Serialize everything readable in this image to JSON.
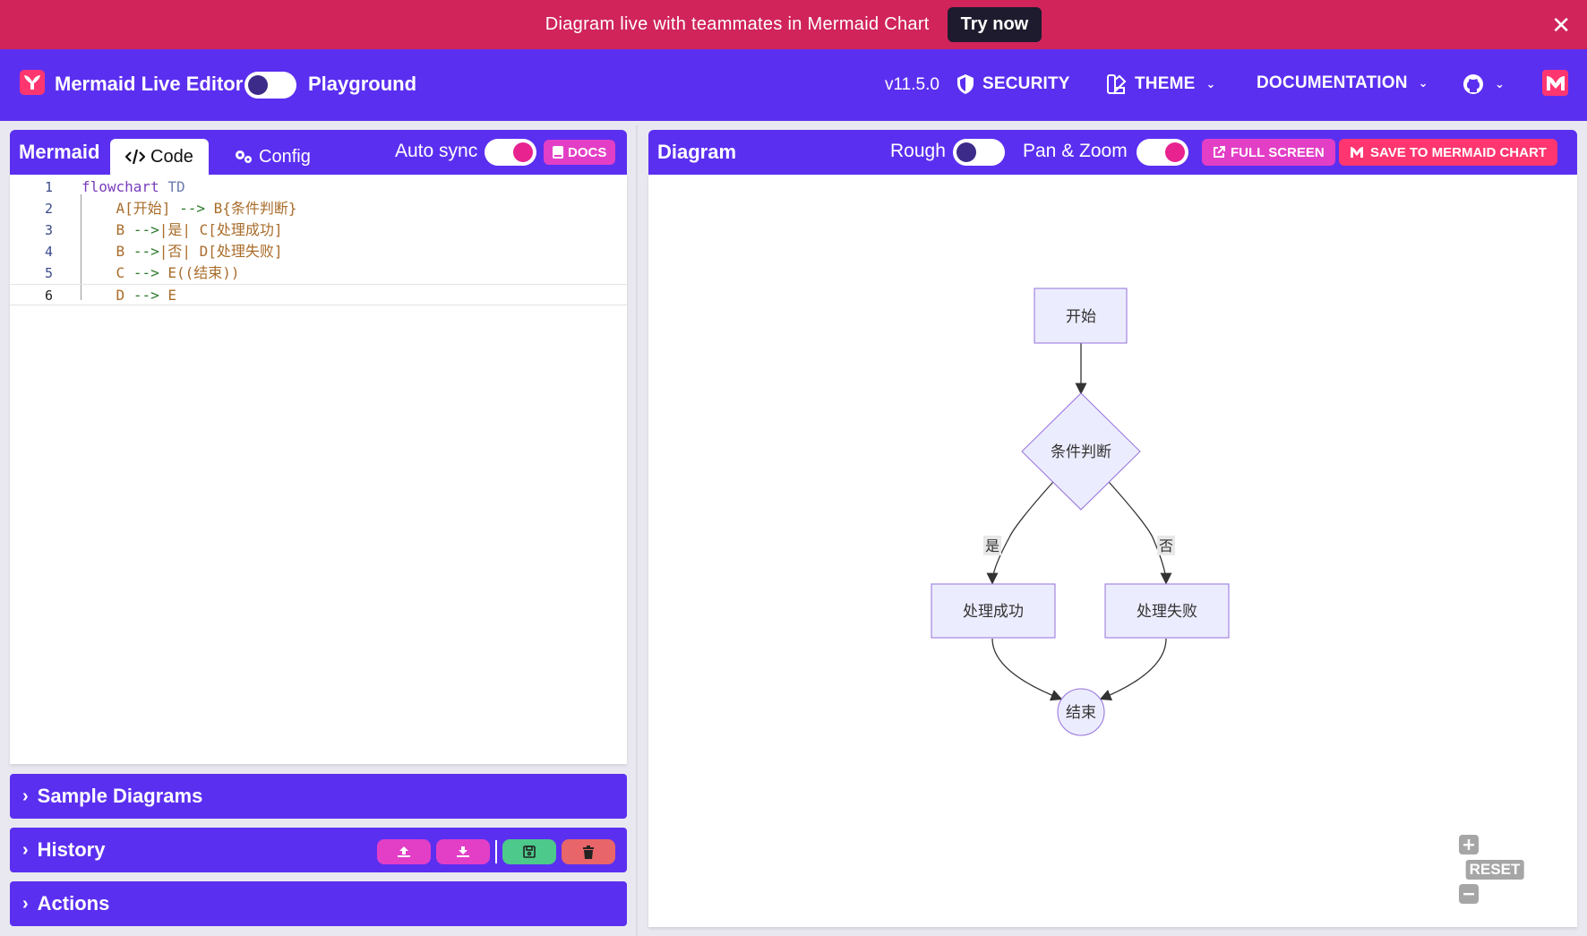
{
  "banner": {
    "text": "Diagram live with teammates in Mermaid Chart",
    "button": "Try now",
    "close": "✕"
  },
  "header": {
    "title": "Mermaid Live Editor",
    "playground": "Playground",
    "version": "v11.5.0",
    "nav": {
      "security": "SECURITY",
      "theme": "THEME",
      "documentation": "DOCUMENTATION"
    }
  },
  "editor_panel": {
    "title": "Mermaid",
    "tabs": [
      "Code",
      "Config"
    ],
    "auto_sync": "Auto sync",
    "docs": "DOCS",
    "lines": [
      {
        "n": "1",
        "parts": [
          [
            "kw",
            "flowchart"
          ],
          [
            "sp",
            " "
          ],
          [
            "dir",
            "TD"
          ]
        ]
      },
      {
        "n": "2",
        "parts": [
          [
            "sp",
            "    "
          ],
          [
            "tok",
            "A[开始]"
          ],
          [
            "sp",
            " "
          ],
          [
            "arr",
            "-->"
          ],
          [
            "sp",
            " "
          ],
          [
            "tok",
            "B{条件判断}"
          ]
        ]
      },
      {
        "n": "3",
        "parts": [
          [
            "sp",
            "    "
          ],
          [
            "tok",
            "B"
          ],
          [
            "sp",
            " "
          ],
          [
            "arr",
            "-->"
          ],
          [
            "tok",
            "|是|"
          ],
          [
            "sp",
            " "
          ],
          [
            "tok",
            "C[处理成功]"
          ]
        ]
      },
      {
        "n": "4",
        "parts": [
          [
            "sp",
            "    "
          ],
          [
            "tok",
            "B"
          ],
          [
            "sp",
            " "
          ],
          [
            "arr",
            "-->"
          ],
          [
            "tok",
            "|否|"
          ],
          [
            "sp",
            " "
          ],
          [
            "tok",
            "D[处理失败]"
          ]
        ]
      },
      {
        "n": "5",
        "parts": [
          [
            "sp",
            "    "
          ],
          [
            "tok",
            "C"
          ],
          [
            "sp",
            " "
          ],
          [
            "arr",
            "-->"
          ],
          [
            "sp",
            " "
          ],
          [
            "tok",
            "E((结束))"
          ]
        ]
      },
      {
        "n": "6",
        "parts": [
          [
            "sp",
            "    "
          ],
          [
            "tok",
            "D"
          ],
          [
            "sp",
            " "
          ],
          [
            "arr",
            "-->"
          ],
          [
            "sp",
            " "
          ],
          [
            "tok",
            "E"
          ]
        ]
      }
    ]
  },
  "accordions": {
    "samples": "Sample Diagrams",
    "history": "History",
    "actions": "Actions"
  },
  "diagram_panel": {
    "title": "Diagram",
    "rough": "Rough",
    "pan_zoom": "Pan & Zoom",
    "full_screen": "FULL SCREEN",
    "save": "SAVE TO MERMAID CHART"
  },
  "flowchart": {
    "start": "开始",
    "decision": "条件判断",
    "yes": "是",
    "no": "否",
    "success": "处理成功",
    "failure": "处理失败",
    "end": "结束"
  },
  "zoom": {
    "reset": "RESET"
  },
  "colors": {
    "brand": "#5b2ff0",
    "banner": "#d0245b",
    "pink": "#e23fc6",
    "accent": "#ff3670"
  }
}
